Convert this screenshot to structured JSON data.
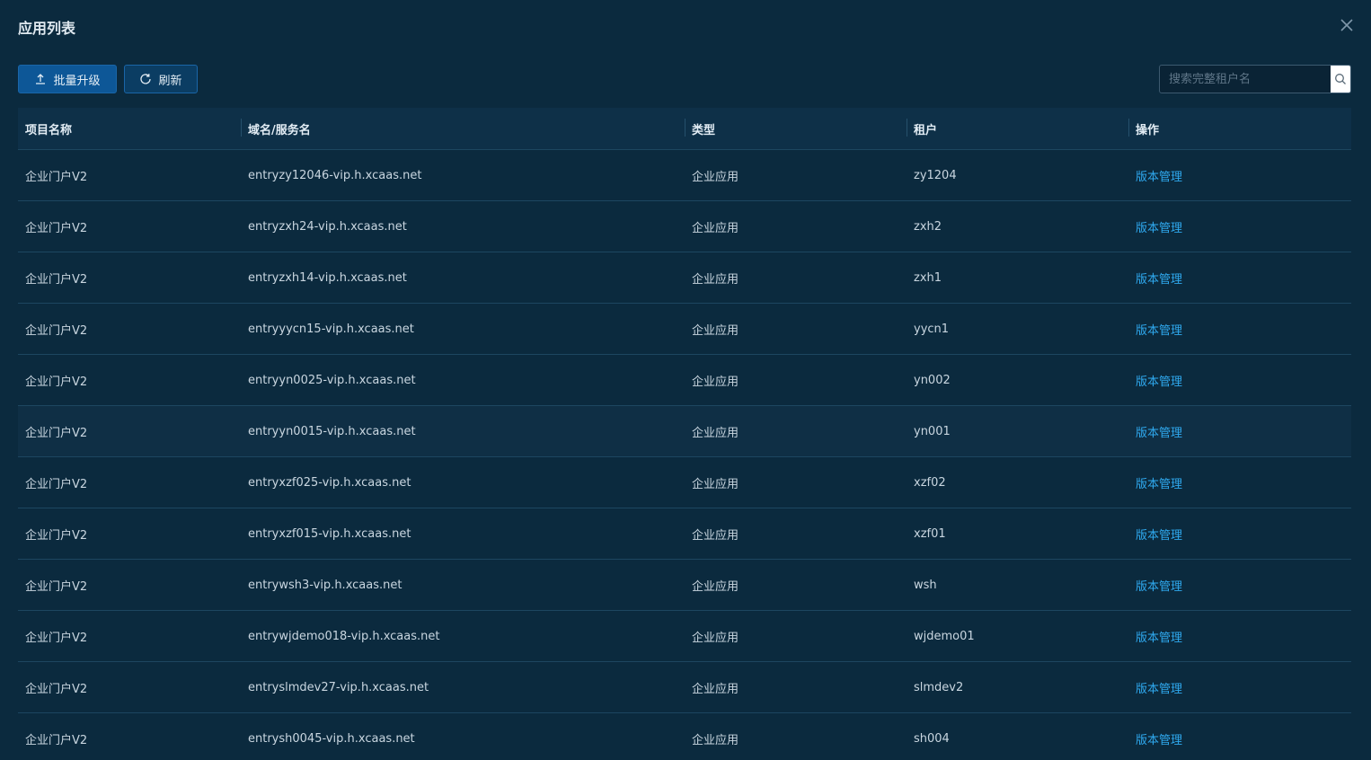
{
  "dialog": {
    "title": "应用列表"
  },
  "toolbar": {
    "upgrade_label": "批量升级",
    "refresh_label": "刷新"
  },
  "search": {
    "placeholder": "搜索完整租户名",
    "value": ""
  },
  "table": {
    "columns": [
      "项目名称",
      "域名/服务名",
      "类型",
      "租户",
      "操作"
    ],
    "rows": [
      {
        "name": "企业门户V2",
        "domain": "entryzy12046-vip.h.xcaas.net",
        "type": "企业应用",
        "tenant": "zy1204",
        "action": "版本管理"
      },
      {
        "name": "企业门户V2",
        "domain": "entryzxh24-vip.h.xcaas.net",
        "type": "企业应用",
        "tenant": "zxh2",
        "action": "版本管理"
      },
      {
        "name": "企业门户V2",
        "domain": "entryzxh14-vip.h.xcaas.net",
        "type": "企业应用",
        "tenant": "zxh1",
        "action": "版本管理"
      },
      {
        "name": "企业门户V2",
        "domain": "entryyycn15-vip.h.xcaas.net",
        "type": "企业应用",
        "tenant": "yycn1",
        "action": "版本管理"
      },
      {
        "name": "企业门户V2",
        "domain": "entryyn0025-vip.h.xcaas.net",
        "type": "企业应用",
        "tenant": "yn002",
        "action": "版本管理"
      },
      {
        "name": "企业门户V2",
        "domain": "entryyn0015-vip.h.xcaas.net",
        "type": "企业应用",
        "tenant": "yn001",
        "action": "版本管理"
      },
      {
        "name": "企业门户V2",
        "domain": "entryxzf025-vip.h.xcaas.net",
        "type": "企业应用",
        "tenant": "xzf02",
        "action": "版本管理"
      },
      {
        "name": "企业门户V2",
        "domain": "entryxzf015-vip.h.xcaas.net",
        "type": "企业应用",
        "tenant": "xzf01",
        "action": "版本管理"
      },
      {
        "name": "企业门户V2",
        "domain": "entrywsh3-vip.h.xcaas.net",
        "type": "企业应用",
        "tenant": "wsh",
        "action": "版本管理"
      },
      {
        "name": "企业门户V2",
        "domain": "entrywjdemo018-vip.h.xcaas.net",
        "type": "企业应用",
        "tenant": "wjdemo01",
        "action": "版本管理"
      },
      {
        "name": "企业门户V2",
        "domain": "entryslmdev27-vip.h.xcaas.net",
        "type": "企业应用",
        "tenant": "slmdev2",
        "action": "版本管理"
      },
      {
        "name": "企业门户V2",
        "domain": "entrysh0045-vip.h.xcaas.net",
        "type": "企业应用",
        "tenant": "sh004",
        "action": "版本管理"
      }
    ]
  }
}
